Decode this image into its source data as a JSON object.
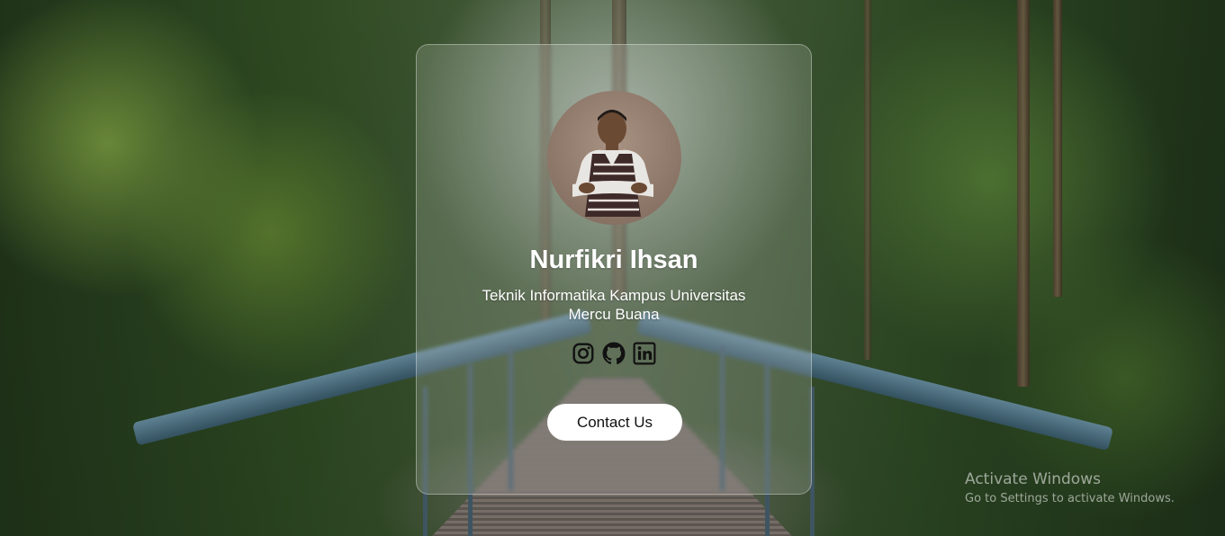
{
  "profile": {
    "name": "Nurfikri Ihsan",
    "subtitle_line1": "Teknik Informatika Kampus Universitas",
    "subtitle_line2": "Mercu Buana",
    "avatar_icon": "person-photo-icon"
  },
  "socials": [
    {
      "icon": "instagram-icon"
    },
    {
      "icon": "github-icon"
    },
    {
      "icon": "linkedin-icon"
    }
  ],
  "contact_button": {
    "label": "Contact Us"
  },
  "watermark": {
    "title": "Activate Windows",
    "subtitle": "Go to Settings to activate Windows."
  },
  "colors": {
    "card_text": "#ffffff",
    "button_bg": "#ffffff",
    "icon_color": "#111111"
  }
}
